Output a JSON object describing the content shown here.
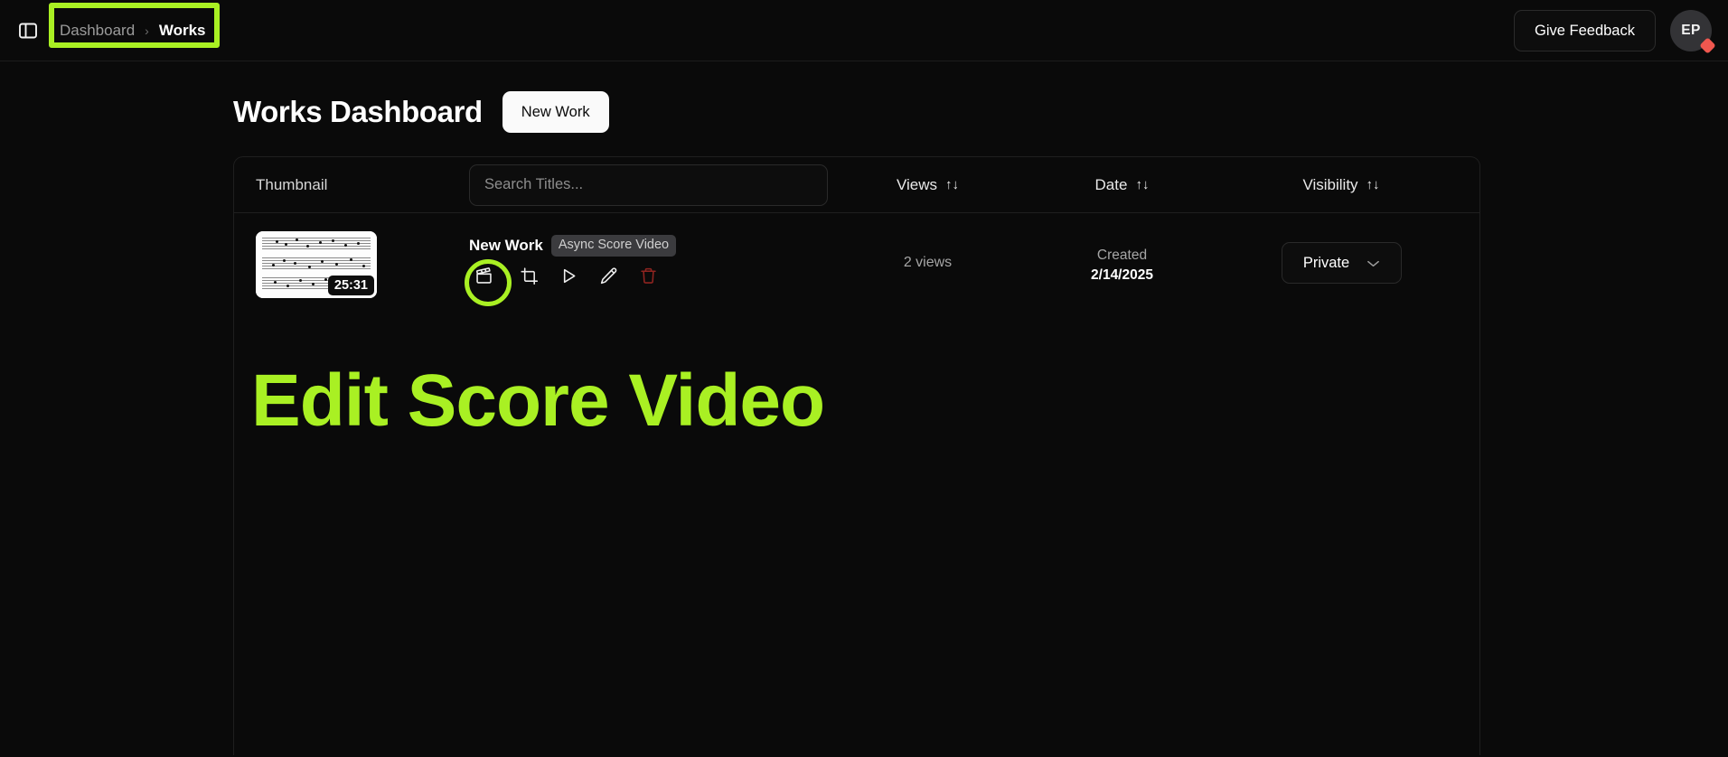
{
  "header": {
    "panel_toggle_icon": "sidebar-panel-icon",
    "breadcrumb": {
      "parent": "Dashboard",
      "separator": "›",
      "current": "Works"
    },
    "feedback_label": "Give Feedback",
    "avatar_initials": "EP"
  },
  "page": {
    "title": "Works Dashboard",
    "new_work_label": "New Work"
  },
  "table": {
    "headers": {
      "thumbnail": "Thumbnail",
      "views": "Views",
      "date": "Date",
      "visibility": "Visibility",
      "sort_icon": "↑↓"
    },
    "search": {
      "value": "",
      "placeholder": "Search Titles..."
    },
    "rows": [
      {
        "thumbnail_duration": "25:31",
        "title": "New Work",
        "tag": "Async Score Video",
        "actions": [
          {
            "name": "edit-score-video",
            "icon": "clapperboard-icon",
            "highlighted": true
          },
          {
            "name": "crop",
            "icon": "crop-icon",
            "highlighted": false
          },
          {
            "name": "play",
            "icon": "play-icon",
            "highlighted": false
          },
          {
            "name": "rename",
            "icon": "pencil-icon",
            "highlighted": false
          },
          {
            "name": "delete",
            "icon": "trash-icon",
            "highlighted": false
          }
        ],
        "views": "2 views",
        "date_label": "Created",
        "date_value": "2/14/2025",
        "visibility": "Private"
      }
    ]
  },
  "annotation": {
    "text": "Edit Score Video",
    "color": "#a9f023"
  }
}
